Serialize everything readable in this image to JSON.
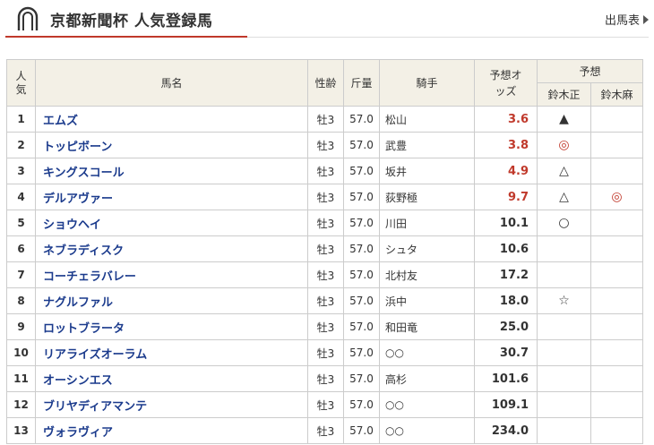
{
  "page": {
    "title": "京都新聞杯 人気登録馬",
    "link_label": "出馬表"
  },
  "table": {
    "headers": {
      "popularity": "人気",
      "name": "馬名",
      "sex_age": "性齢",
      "weight": "斤量",
      "jockey": "騎手",
      "odds": "予想オッズ",
      "prediction": "予想",
      "predictor1": "鈴木正",
      "predictor2": "鈴木麻"
    },
    "rows": [
      {
        "pop": "1",
        "name": "エムズ",
        "sex": "牡3",
        "wt": "57.0",
        "jockey": "松山",
        "odds": "3.6",
        "hot": true,
        "m1": "▲",
        "m2": ""
      },
      {
        "pop": "2",
        "name": "トッピボーン",
        "sex": "牡3",
        "wt": "57.0",
        "jockey": "武豊",
        "odds": "3.8",
        "hot": true,
        "m1": "◎",
        "m2": ""
      },
      {
        "pop": "3",
        "name": "キングスコール",
        "sex": "牡3",
        "wt": "57.0",
        "jockey": "坂井",
        "odds": "4.9",
        "hot": true,
        "m1": "△",
        "m2": ""
      },
      {
        "pop": "4",
        "name": "デルアヴァー",
        "sex": "牡3",
        "wt": "57.0",
        "jockey": "荻野極",
        "odds": "9.7",
        "hot": true,
        "m1": "△",
        "m2": "◎"
      },
      {
        "pop": "5",
        "name": "ショウヘイ",
        "sex": "牡3",
        "wt": "57.0",
        "jockey": "川田",
        "odds": "10.1",
        "hot": false,
        "m1": "○",
        "m2": ""
      },
      {
        "pop": "6",
        "name": "ネブラディスク",
        "sex": "牡3",
        "wt": "57.0",
        "jockey": "シュタ",
        "odds": "10.6",
        "hot": false,
        "m1": "",
        "m2": ""
      },
      {
        "pop": "7",
        "name": "コーチェラバレー",
        "sex": "牡3",
        "wt": "57.0",
        "jockey": "北村友",
        "odds": "17.2",
        "hot": false,
        "m1": "",
        "m2": ""
      },
      {
        "pop": "8",
        "name": "ナグルファル",
        "sex": "牡3",
        "wt": "57.0",
        "jockey": "浜中",
        "odds": "18.0",
        "hot": false,
        "m1": "☆",
        "m2": ""
      },
      {
        "pop": "9",
        "name": "ロットブラータ",
        "sex": "牡3",
        "wt": "57.0",
        "jockey": "和田竜",
        "odds": "25.0",
        "hot": false,
        "m1": "",
        "m2": ""
      },
      {
        "pop": "10",
        "name": "リアライズオーラム",
        "sex": "牡3",
        "wt": "57.0",
        "jockey": "○○",
        "odds": "30.7",
        "hot": false,
        "m1": "",
        "m2": ""
      },
      {
        "pop": "11",
        "name": "オーシンエス",
        "sex": "牡3",
        "wt": "57.0",
        "jockey": "高杉",
        "odds": "101.6",
        "hot": false,
        "m1": "",
        "m2": ""
      },
      {
        "pop": "12",
        "name": "ブリヤディアマンテ",
        "sex": "牡3",
        "wt": "57.0",
        "jockey": "○○",
        "odds": "109.1",
        "hot": false,
        "m1": "",
        "m2": ""
      },
      {
        "pop": "13",
        "name": "ヴォラヴィア",
        "sex": "牡3",
        "wt": "57.0",
        "jockey": "○○",
        "odds": "234.0",
        "hot": false,
        "m1": "",
        "m2": ""
      }
    ]
  },
  "colors": {
    "accent_red": "#c0392b",
    "link_blue": "#1a3a8c",
    "header_bg": "#f3f0e6"
  }
}
